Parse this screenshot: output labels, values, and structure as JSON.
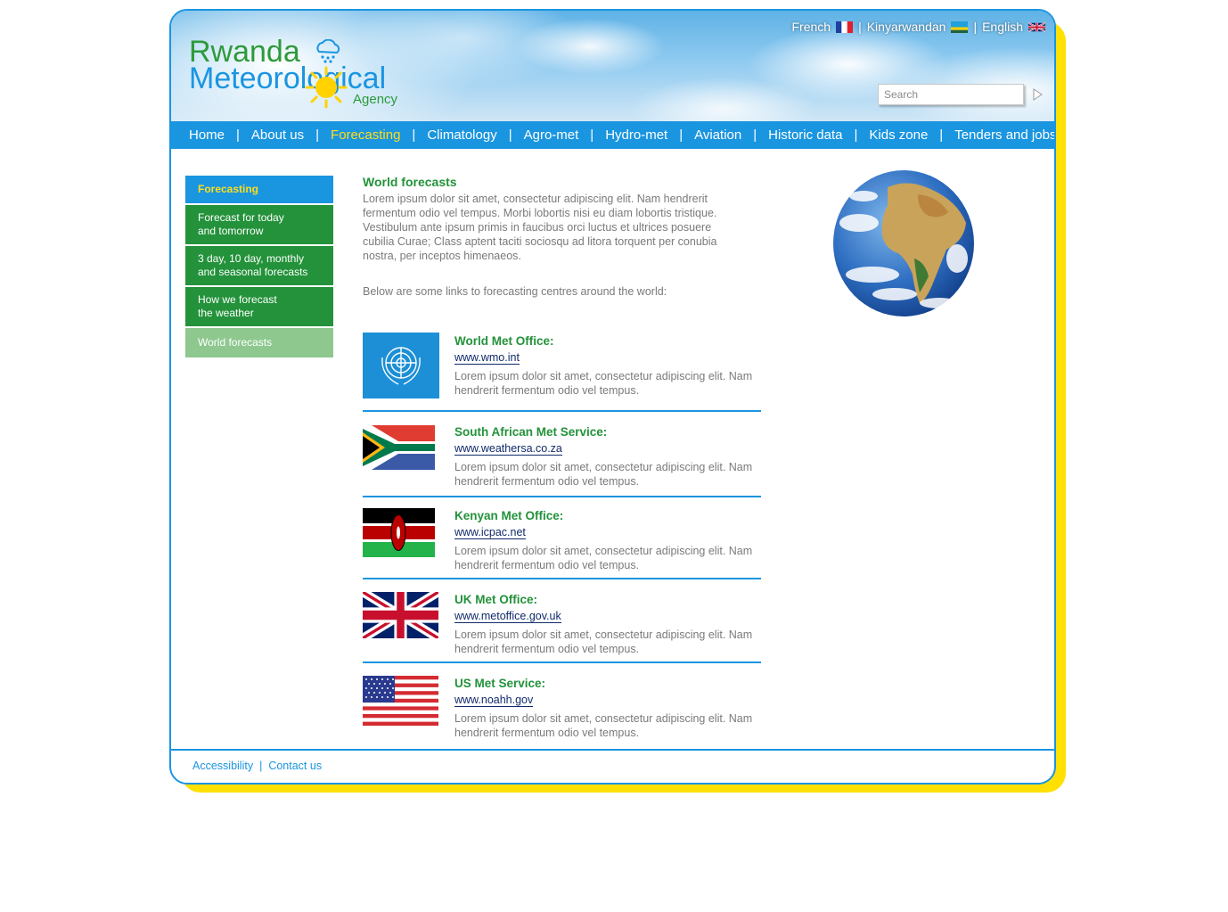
{
  "header": {
    "logo": {
      "line1": "Rwanda",
      "line2": "Meteorological",
      "line3": "Agency"
    },
    "languages": [
      {
        "label": "French",
        "flag": "france-flag-icon"
      },
      {
        "label": "Kinyarwandan",
        "flag": "rwanda-flag-icon"
      },
      {
        "label": "English",
        "flag": "uk-flag-icon"
      }
    ],
    "language_separator": "|",
    "search": {
      "placeholder": "Search",
      "button_icon": "arrow-right-icon"
    }
  },
  "nav": {
    "items": [
      "Home",
      "About us",
      "Forecasting",
      "Climatology",
      "Agro-met",
      "Hydro-met",
      "Aviation",
      "Historic data",
      "Kids zone",
      "Tenders and jobs"
    ],
    "active": "Forecasting",
    "separator": "|"
  },
  "sidebar": {
    "heading": "Forecasting",
    "items": [
      {
        "line1": "Forecast for today",
        "line2": "and tomorrow"
      },
      {
        "line1": "3 day, 10 day, monthly",
        "line2": "and seasonal forecasts"
      },
      {
        "line1": "How we forecast",
        "line2": "the weather"
      },
      {
        "line1": "World forecasts",
        "line2": ""
      }
    ],
    "active": "World forecasts"
  },
  "main": {
    "title": "World forecasts",
    "intro": "Lorem ipsum dolor sit amet, consectetur adipiscing elit. Nam hendrerit fermentum odio vel tempus. Morbi lobortis nisi eu diam lobortis tristique. Vestibulum ante ipsum primis in faucibus orci luctus et ultrices posuere cubilia Curae; Class aptent taciti sociosqu ad litora torquent per conubia nostra, per inceptos himenaeos.",
    "links_intro": "Below are some links to forecasting centres around the world:",
    "centres": [
      {
        "name": "World Met Office:",
        "url": "www.wmo.int",
        "flag": "un-flag-icon",
        "description": "Lorem ipsum dolor sit amet, consectetur adipiscing elit. Nam hendrerit fermentum odio vel tempus."
      },
      {
        "name": "South African Met Service:",
        "url": "www.weathersa.co.za",
        "flag": "south-africa-flag-icon",
        "description": "Lorem ipsum dolor sit amet, consectetur adipiscing elit. Nam hendrerit fermentum odio vel tempus."
      },
      {
        "name": "Kenyan Met Office:",
        "url": "www.icpac.net",
        "flag": "kenya-flag-icon",
        "description": "Lorem ipsum dolor sit amet, consectetur adipiscing elit. Nam hendrerit fermentum odio vel tempus."
      },
      {
        "name": "UK Met Office:",
        "url": "www.metoffice.gov.uk",
        "flag": "uk-flag-icon",
        "description": "Lorem ipsum dolor sit amet, consectetur adipiscing elit. Nam hendrerit fermentum odio vel tempus."
      },
      {
        "name": "US Met Service:",
        "url": "www.noahh.gov",
        "flag": "us-flag-icon",
        "description": "Lorem ipsum dolor sit amet, consectetur adipiscing elit. Nam hendrerit fermentum odio vel tempus."
      }
    ]
  },
  "footer": {
    "links": [
      "Accessibility",
      "Contact us"
    ],
    "separator": "|"
  },
  "colors": {
    "brand_blue": "#1a95e0",
    "brand_green": "#23923a",
    "accent_yellow": "#ffde1a",
    "light_green": "#8ec88f",
    "text_grey": "#7a7a7a"
  }
}
